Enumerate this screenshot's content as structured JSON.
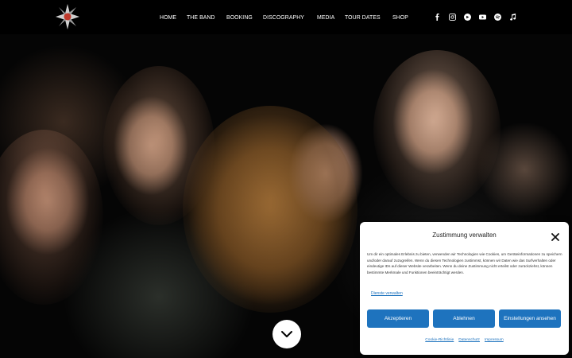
{
  "nav": {
    "items": [
      "HOME",
      "THE BAND",
      "BOOKING",
      "DISCOGRAPHY",
      "MEDIA",
      "TOUR DATES",
      "SHOP"
    ]
  },
  "social": {
    "icons": [
      "facebook-icon",
      "instagram-icon",
      "music-platform-icon",
      "youtube-icon",
      "spotify-icon",
      "music-note-icon"
    ]
  },
  "colors": {
    "header_bg": "#000000",
    "accent_blue": "#1e73be"
  },
  "consent": {
    "title": "Zustimmung verwalten",
    "text": "Um dir ein optimales Erlebnis zu bieten, verwenden wir Technologien wie Cookies, um Geräteinformationen zu speichern und/oder darauf zuzugreifen. Wenn du diesen Technologien zustimmst, können wir Daten wie das Surfverhalten oder eindeutige IDs auf dieser Website verarbeiten. Wenn du deine Zustimmung nicht erteilst oder zurückziehst, können bestimmte Merkmale und Funktionen beeinträchtigt werden.",
    "manage_link": "Dienste verwalten",
    "buttons": {
      "accept": "Akzeptieren",
      "deny": "Ablehnen",
      "settings": "Einstellungen ansehen"
    },
    "links": [
      "Cookie-Richtlinie",
      "Datenschutz",
      "Impressum"
    ]
  }
}
